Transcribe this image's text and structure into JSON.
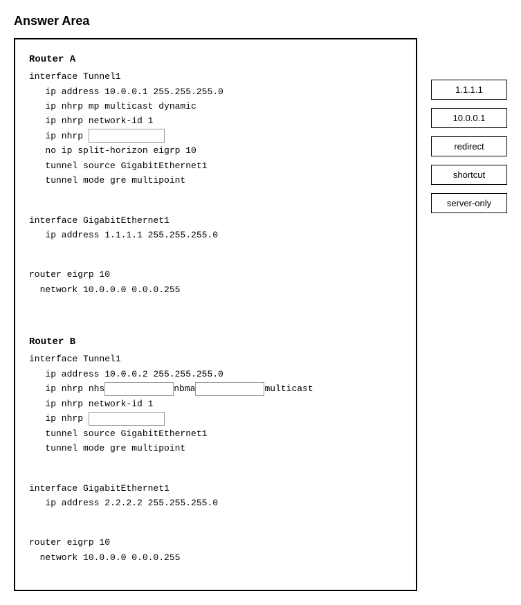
{
  "page": {
    "title": "Answer Area"
  },
  "answer_box": {
    "router_a": {
      "header": "Router A",
      "lines": [
        "interface Tunnel1",
        "   ip address 10.0.0.1 255.255.255.0",
        "   ip nhrp mp multicast dynamic",
        "   ip nhrp network-id 1",
        "   ip nhrp ",
        "   no ip split-horizon eigrp 10",
        "   tunnel source GigabitEthernet1",
        "   tunnel mode gre multipoint",
        "",
        "interface GigabitEthernet1",
        "   ip address 1.1.1.1 255.255.255.0",
        "",
        "router eigrp 10",
        "   network 10.0.0.0 0.0.0.255"
      ]
    },
    "router_b": {
      "header": "Router B",
      "lines": [
        "interface Tunnel1",
        "   ip address 10.0.0.2 255.255.255.0",
        "   ip nhrp nhs       nbma        multicast",
        "   ip nhrp network-id 1",
        "   ip nhrp ",
        "   tunnel source GigabitEthernet1",
        "   tunnel mode gre multipoint",
        "",
        "interface GigabitEthernet1",
        "   ip address 2.2.2.2 255.255.255.0",
        "",
        "router eigrp 10",
        "   network 10.0.0.0 0.0.0.255"
      ]
    }
  },
  "options": [
    {
      "id": "opt-1",
      "label": "1.1.1.1"
    },
    {
      "id": "opt-2",
      "label": "10.0.0.1"
    },
    {
      "id": "opt-3",
      "label": "redirect"
    },
    {
      "id": "opt-4",
      "label": "shortcut"
    },
    {
      "id": "opt-5",
      "label": "server-only"
    }
  ]
}
